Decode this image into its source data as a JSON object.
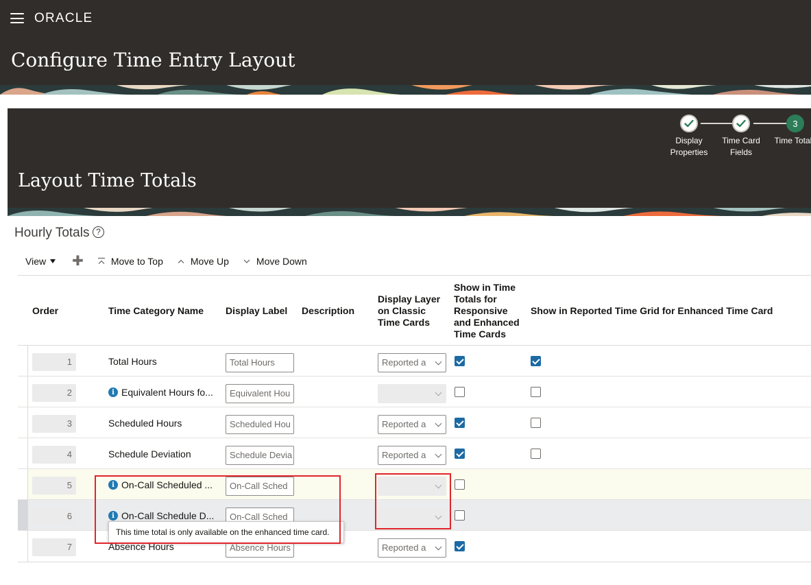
{
  "app": {
    "brand": "ORACLE",
    "page_title": "Configure Time Entry Layout"
  },
  "train": {
    "section_title": "Layout Time Totals",
    "steps": [
      {
        "label_line1": "Display",
        "label_line2": "Properties",
        "state": "completed"
      },
      {
        "label_line1": "Time Card",
        "label_line2": "Fields",
        "state": "completed"
      },
      {
        "label_line1": "Time Totals",
        "label_line2": "",
        "state": "current",
        "number": "3"
      }
    ]
  },
  "hourly_totals": {
    "title": "Hourly Totals",
    "help_glyph": "?"
  },
  "toolbar": {
    "view_label": "View",
    "add_glyph": "✚",
    "move_to_top_label": "Move to Top",
    "move_up_label": "Move Up",
    "move_down_label": "Move Down"
  },
  "table": {
    "columns": {
      "order": "Order",
      "time_category_name": "Time Category Name",
      "display_label": "Display Label",
      "description": "Description",
      "display_layer_l1": "Display Layer",
      "display_layer_l2": "on Classic",
      "display_layer_l3": "Time Cards",
      "show_totals_l1": "Show in Time",
      "show_totals_l2": "Totals for",
      "show_totals_l3": "Responsive",
      "show_totals_l4": "and Enhanced",
      "show_totals_l5": "Time Cards",
      "show_grid": "Show in Reported Time Grid for Enhanced Time Card"
    },
    "rows": [
      {
        "order": "1",
        "name": "Total Hours",
        "info": false,
        "label": "Total Hours",
        "layer": "Reported a",
        "layer_disabled": false,
        "totals": true,
        "grid": true,
        "grid_visible": true
      },
      {
        "order": "2",
        "name": "Equivalent Hours fo...",
        "info": true,
        "label": "Equivalent Hou",
        "layer": "",
        "layer_disabled": true,
        "totals": false,
        "grid": false,
        "grid_visible": true
      },
      {
        "order": "3",
        "name": "Scheduled Hours",
        "info": false,
        "label": "Scheduled Hou",
        "layer": "Reported a",
        "layer_disabled": false,
        "totals": true,
        "grid": false,
        "grid_visible": true
      },
      {
        "order": "4",
        "name": "Schedule Deviation",
        "info": false,
        "label": "Schedule Devia",
        "layer": "Reported a",
        "layer_disabled": false,
        "totals": true,
        "grid": false,
        "grid_visible": true
      },
      {
        "order": "5",
        "name": "On-Call Scheduled ...",
        "info": true,
        "label": "On-Call Sched",
        "layer": "",
        "layer_disabled": true,
        "totals": false,
        "grid": false,
        "grid_visible": false
      },
      {
        "order": "6",
        "name": "On-Call Schedule D...",
        "info": true,
        "label": "On-Call Sched",
        "layer": "",
        "layer_disabled": true,
        "totals": false,
        "grid": false,
        "grid_visible": false
      },
      {
        "order": "7",
        "name": "Absence Hours",
        "info": false,
        "label": "Absence Hours",
        "layer": "Reported a",
        "layer_disabled": false,
        "totals": true,
        "grid": false,
        "grid_visible": false
      }
    ]
  },
  "tooltip": {
    "text": "This time total is only available on the enhanced time card."
  },
  "colors": {
    "header_bg": "#312d2a",
    "step_current": "#2c7d58",
    "checkbox_checked": "#1c6aa4",
    "info_icon": "#227ab3",
    "highlight": "#e0252b"
  }
}
